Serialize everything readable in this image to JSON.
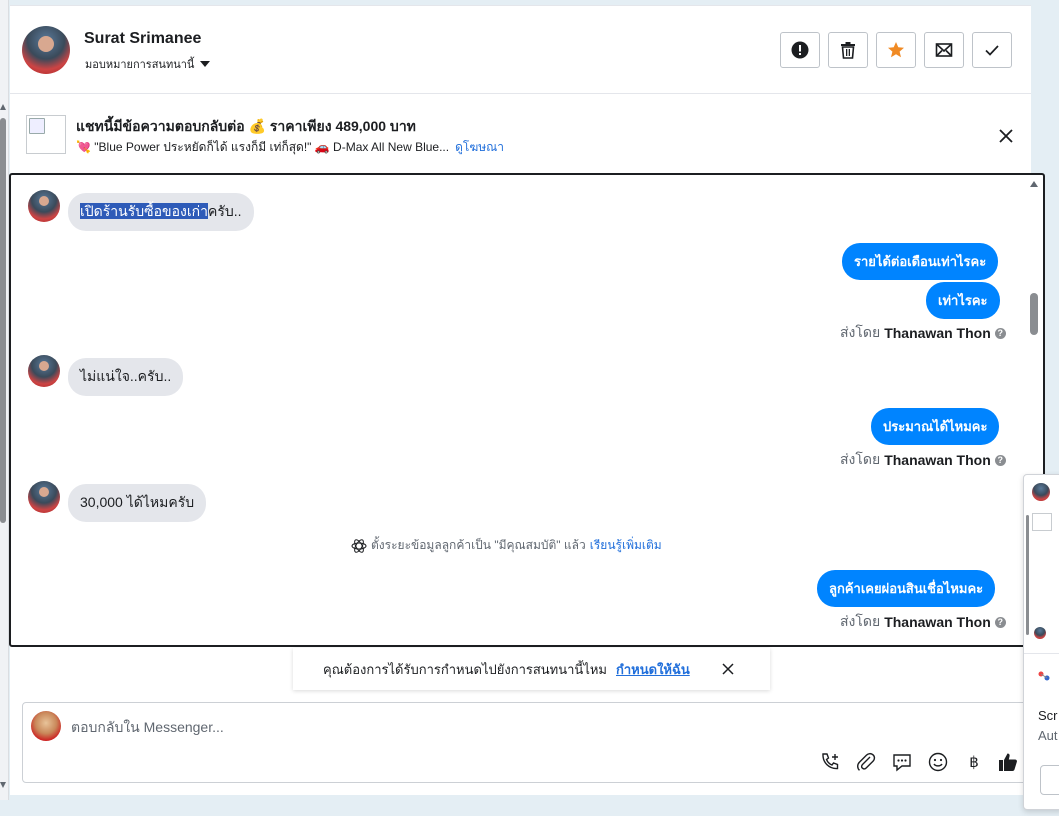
{
  "header": {
    "contact_name": "Surat Srimanee",
    "assign_label": "มอบหมายการสนทนานี้"
  },
  "ad": {
    "title": "แชทนี้มีข้อความตอบกลับต่อ 💰 ราคาเพียง 489,000 บาท",
    "description": "💘 \"Blue Power ประหยัดก็ได้ แรงก็มี เท่ก็สุด!\" 🚗 D-Max All New Blue...",
    "link": "ดูโฆษณา"
  },
  "messages": {
    "m1_selected": "เปิดร้านรับซื้อของเก่า",
    "m1_rest": "ครับ..",
    "m2": "รายได้ต่อเดือนเท่าไรคะ",
    "m3": "เท่าไรคะ",
    "m4": "ไม่แน่ใจ..ครับ..",
    "m5": "ประมาณได้ไหมคะ",
    "m6": "30,000 ได้ไหมครับ",
    "m7": "ลูกค้าเคยผ่อนสินเชื่อไหมคะ"
  },
  "sent_by": {
    "prefix": "ส่งโดย",
    "agent": "Thanawan Thon"
  },
  "system_note": {
    "text": "ตั้งระยะข้อมูลลูกค้าเป็น \"มีคุณสมบัติ\" แล้ว",
    "link": "เรียนรู้เพิ่มเติม"
  },
  "prompt": {
    "text": "คุณต้องการได้รับการกำหนดไปยังการสนทนานี้ไหม",
    "link": "กำหนดให้ฉัน"
  },
  "composer": {
    "placeholder": "ตอบกลับใน Messenger..."
  },
  "right_panel": {
    "text1": "Scr",
    "text2": "Aut"
  }
}
